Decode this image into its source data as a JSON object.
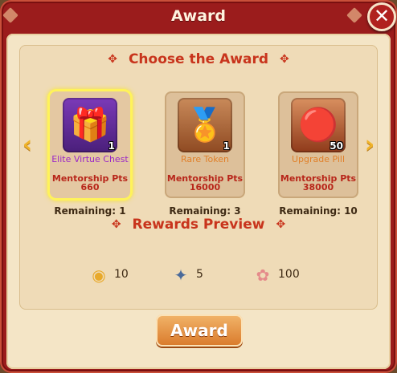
{
  "dialog": {
    "title": "Award",
    "close_label": "✕"
  },
  "choose_section": {
    "title": "Choose the Award"
  },
  "items": [
    {
      "name": "Elite Virtue Chest",
      "qty": "1",
      "points_label": "Mentorship Pts",
      "points": "660",
      "remaining": "Remaining: 1",
      "icon": "gift-chest-icon",
      "name_color": "#9a28c7",
      "selected": true
    },
    {
      "name": "Rare Token",
      "qty": "1",
      "points_label": "Mentorship Pts",
      "points": "16000",
      "remaining": "Remaining: 3",
      "icon": "token-icon",
      "name_color": "#e0802a",
      "selected": false
    },
    {
      "name": "Upgrade Pill",
      "qty": "50",
      "points_label": "Mentorship Pts",
      "points": "38000",
      "remaining": "Remaining: 10",
      "icon": "pill-box-icon",
      "name_color": "#e0802a",
      "selected": false
    }
  ],
  "preview_section": {
    "title": "Rewards Preview"
  },
  "rewards": [
    {
      "icon": "coin-icon",
      "value": "10"
    },
    {
      "icon": "fan-icon",
      "value": "5"
    },
    {
      "icon": "blossom-icon",
      "value": "100"
    }
  ],
  "award_button": "Award",
  "colors": {
    "frame": "#9b1c1c",
    "panel": "#f4e5c6",
    "accent": "#c8341c",
    "selected_glow": "#fff35a"
  }
}
